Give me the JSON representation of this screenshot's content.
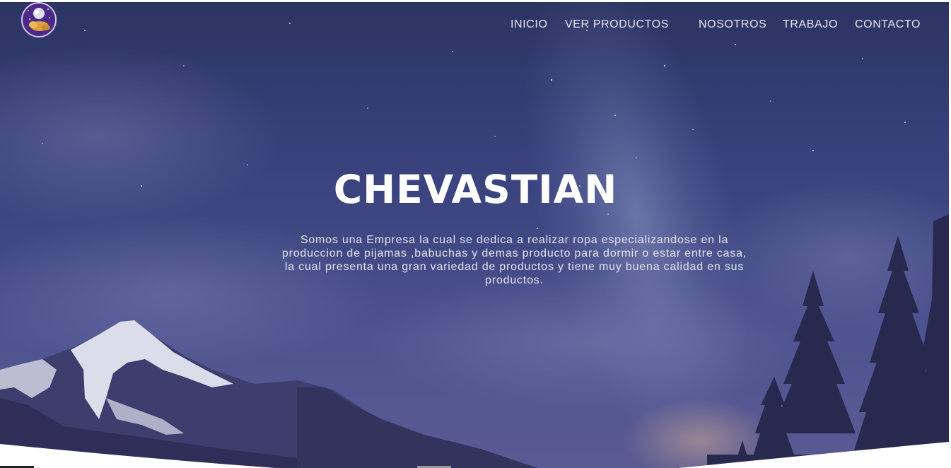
{
  "brand": {
    "logo_icon": "sleeping-dog-logo-icon"
  },
  "nav": {
    "items": [
      {
        "label": "INICIO"
      },
      {
        "label": "VER PRODUCTOS"
      },
      {
        "label": "NOSOTROS"
      },
      {
        "label": "TRABAJO"
      },
      {
        "label": "CONTACTO"
      }
    ]
  },
  "hero": {
    "title": "CHEVASTIAN",
    "description_lines": [
      "Somos una Empresa la cual se dedica a realizar ropa especializandose en la",
      "produccion de pijamas ,babuchas y demas producto para dormir o estar entre casa,",
      "la cual presenta una gran variedad de productos y tiene muy buena calidad en sus",
      "productos."
    ]
  },
  "colors": {
    "sky": "#37407a",
    "text": "#ffffff",
    "logo_bg": "#4a2a86"
  }
}
